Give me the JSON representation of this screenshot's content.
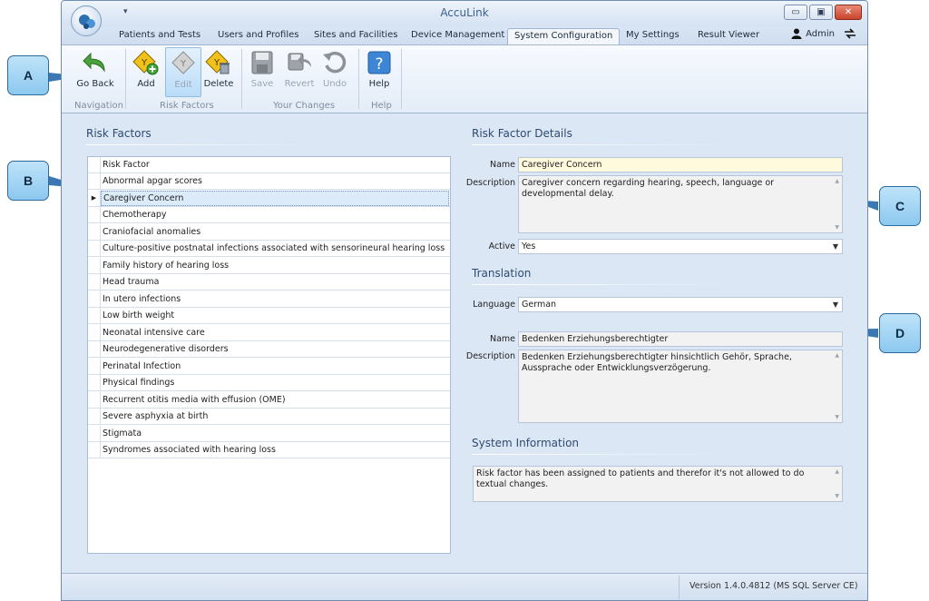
{
  "app": {
    "title": "AccuLink"
  },
  "window_controls": {
    "minimize": "▭",
    "maximize": "▣",
    "close": "✕"
  },
  "tabs": [
    {
      "label": "Patients and Tests"
    },
    {
      "label": "Users and Profiles"
    },
    {
      "label": "Sites and Facilities"
    },
    {
      "label": "Device Management"
    },
    {
      "label": "System Configuration"
    },
    {
      "label": "My Settings"
    },
    {
      "label": "Result Viewer"
    }
  ],
  "user": {
    "name": "Admin"
  },
  "ribbon": {
    "go_back": "Go Back",
    "add": "Add",
    "edit": "Edit",
    "delete": "Delete",
    "save": "Save",
    "revert": "Revert",
    "undo": "Undo",
    "help": "Help",
    "groups": {
      "navigation": "Navigation",
      "risk_factors": "Risk Factors",
      "your_changes": "Your Changes",
      "help": "Help"
    }
  },
  "risk_factors": {
    "title": "Risk Factors",
    "header": "Risk Factor",
    "items": [
      "Abnormal apgar scores",
      "Caregiver Concern",
      "Chemotherapy",
      "Craniofacial anomalies",
      "Culture-positive postnatal infections associated with sensorineural hearing loss",
      "Family history of hearing loss",
      "Head trauma",
      "In utero infections",
      "Low birth weight",
      "Neonatal intensive care",
      "Neurodegenerative disorders",
      "Perinatal Infection",
      "Physical findings",
      "Recurrent otitis media with effusion (OME)",
      "Severe asphyxia at birth",
      "Stigmata",
      "Syndromes associated with hearing loss"
    ],
    "selected_index": 1
  },
  "details": {
    "title": "Risk Factor Details",
    "name_label": "Name",
    "name_value": "Caregiver Concern",
    "description_label": "Description",
    "description_value": "Caregiver concern regarding hearing, speech, language or developmental delay.",
    "active_label": "Active",
    "active_value": "Yes"
  },
  "translation": {
    "title": "Translation",
    "language_label": "Language",
    "language_value": "German",
    "name_label": "Name",
    "name_value": "Bedenken Erziehungsberechtigter",
    "description_label": "Description",
    "description_value": "Bedenken Erziehungsberechtigter hinsichtlich Gehör, Sprache, Aussprache oder Entwicklungsverzögerung."
  },
  "system_info": {
    "title": "System Information",
    "text": "Risk factor has been assigned to patients and therefor it's not allowed to do textual changes."
  },
  "status": {
    "version": "Version 1.4.0.4812 (MS SQL Server CE)"
  },
  "callouts": {
    "a": "A",
    "b": "B",
    "c": "C",
    "d": "D"
  },
  "colors": {
    "accent": "#3b5f8f",
    "highlight_field": "#fff9dd",
    "selected_row": "#dcebf9",
    "callout": "#8cc8ef"
  }
}
